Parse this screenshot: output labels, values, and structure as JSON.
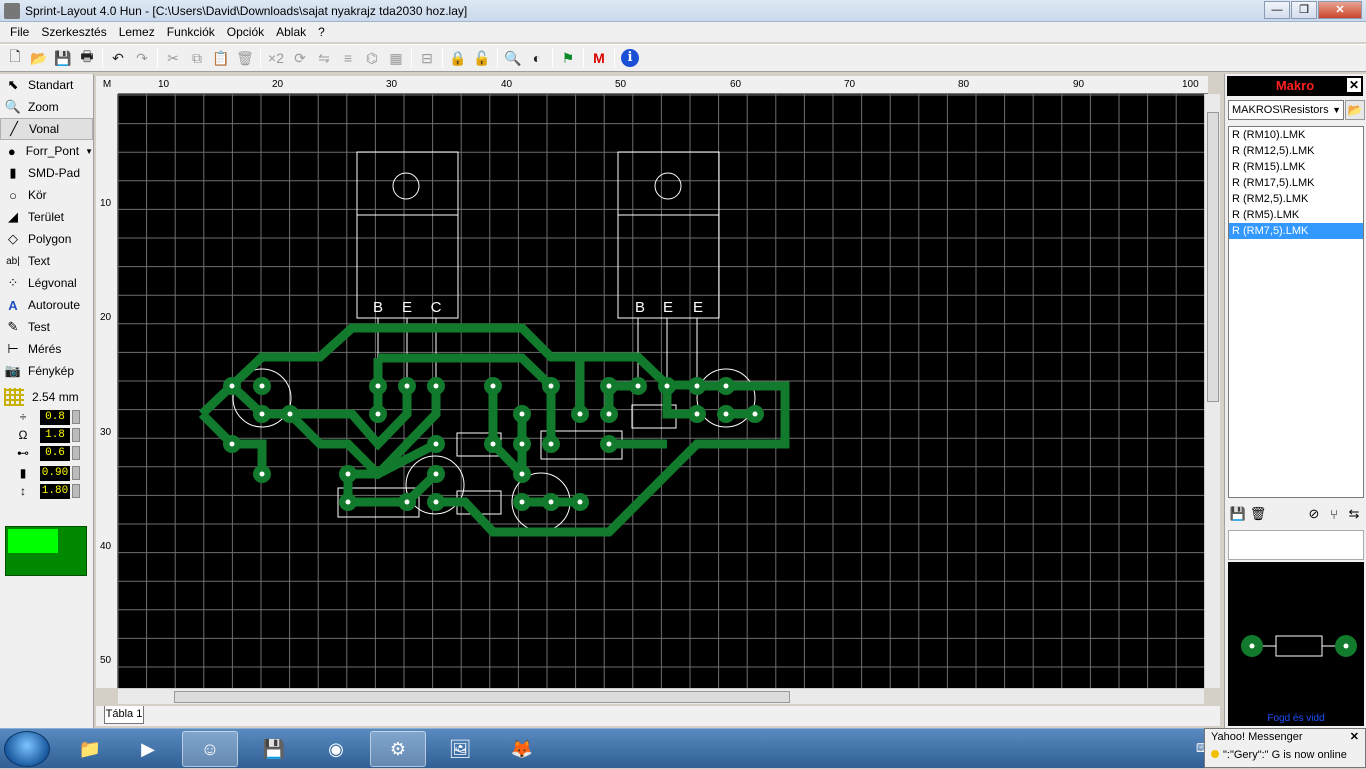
{
  "window": {
    "title": "Sprint-Layout 4.0 Hun - [C:\\Users\\David\\Downloads\\sajat nyakrajz tda2030 hoz.lay]",
    "minimize": "—",
    "maximize": "❐",
    "close": "✕"
  },
  "menu": [
    "File",
    "Szerkesztés",
    "Lemez",
    "Funkciók",
    "Opciók",
    "Ablak",
    "?"
  ],
  "toolbar": {
    "new_icon": "🗋",
    "open_icon": "📂",
    "save_icon": "💾",
    "print_icon": "🖶",
    "undo_icon": "↶",
    "redo_icon": "↷",
    "cut_icon": "✂",
    "copy_icon": "⧉",
    "paste_icon": "📋",
    "delete_icon": "🗑",
    "x2_label": "×2",
    "rotate_icon": "⟳",
    "mirror_icon": "⇋",
    "align_icon": "≡",
    "group_icon": "⌬",
    "snap_icon": "▦",
    "layers_icon": "⊟",
    "lock_icon": "🔒",
    "unlock_icon": "🔓",
    "zoom_icon": "🔍",
    "contrast_icon": "◐",
    "drc_icon": "⚑",
    "macro_icon": "M",
    "info_icon": "i"
  },
  "tools": [
    {
      "icon": "⬉",
      "label": "Standart"
    },
    {
      "icon": "🔍",
      "label": "Zoom"
    },
    {
      "icon": "╱",
      "label": "Vonal"
    },
    {
      "icon": "●",
      "label": "Forr_Pont"
    },
    {
      "icon": "▮",
      "label": "SMD-Pad"
    },
    {
      "icon": "○",
      "label": "Kör"
    },
    {
      "icon": "◢",
      "label": "Terület"
    },
    {
      "icon": "◇",
      "label": "Polygon"
    },
    {
      "icon": "ab|",
      "label": "Text"
    },
    {
      "icon": "⁘",
      "label": "Légvonal"
    },
    {
      "icon": "A",
      "label": "Autoroute"
    },
    {
      "icon": "✎",
      "label": "Test"
    },
    {
      "icon": "⊢",
      "label": "Mérés"
    },
    {
      "icon": "📷",
      "label": "Fénykép"
    }
  ],
  "grid_size": "2.54 mm",
  "params": {
    "track_width": "0.8",
    "pad_outer": "1.8",
    "pad_inner": "0.6",
    "smd_w": "0.90",
    "smd_h": "1.80"
  },
  "ruler": {
    "corner": "M",
    "top": [
      "10",
      "20",
      "30",
      "40",
      "50",
      "60",
      "70",
      "80",
      "90",
      "100"
    ],
    "left": [
      "10",
      "20",
      "30",
      "40",
      "50"
    ]
  },
  "pcb": {
    "labels_left": [
      "B",
      "E",
      "C"
    ],
    "labels_right": [
      "B",
      "E",
      "E"
    ],
    "trace_color": "#0f7a2c",
    "silk_color": "#ffffff",
    "grid_color": "#7a7a7a"
  },
  "sheet_tab": "Tábla 1",
  "makro": {
    "title": "Makro",
    "folder": "MAKROS\\Resistors",
    "items": [
      "R (RM10).LMK",
      "R (RM12,5).LMK",
      "R (RM15).LMK",
      "R (RM17,5).LMK",
      "R (RM2,5).LMK",
      "R (RM5).LMK",
      "R (RM7,5).LMK"
    ],
    "selected_index": 6,
    "preview_caption": "Fogd és vidd"
  },
  "notification": {
    "title": "Yahoo! Messenger",
    "message": "\":\"Gery\":\" G is now online"
  }
}
